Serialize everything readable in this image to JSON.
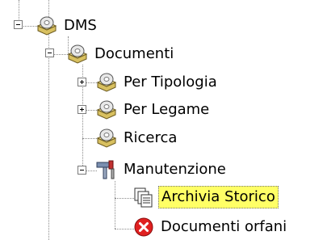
{
  "tree": {
    "root": {
      "label": "DMS",
      "icon": "folder-cd-icon",
      "expanded": true
    },
    "documenti": {
      "label": "Documenti",
      "icon": "folder-cd-icon",
      "expanded": true
    },
    "per_tipologia": {
      "label": "Per Tipologia",
      "icon": "folder-cd-icon",
      "expanded": false
    },
    "per_legame": {
      "label": "Per Legame",
      "icon": "folder-cd-icon",
      "expanded": false
    },
    "ricerca": {
      "label": "Ricerca",
      "icon": "folder-cd-icon"
    },
    "manutenzione": {
      "label": "Manutenzione",
      "icon": "tools-icon",
      "expanded": true
    },
    "archivia_storico": {
      "label": "Archivia Storico",
      "icon": "archive-documents-icon",
      "selected": true
    },
    "documenti_orfani": {
      "label": "Documenti orfani",
      "icon": "error-icon"
    }
  },
  "colors": {
    "selection": "#ffff66",
    "connector": "#8a8a8a",
    "error": "#e02020",
    "folder": "#e8d070"
  }
}
